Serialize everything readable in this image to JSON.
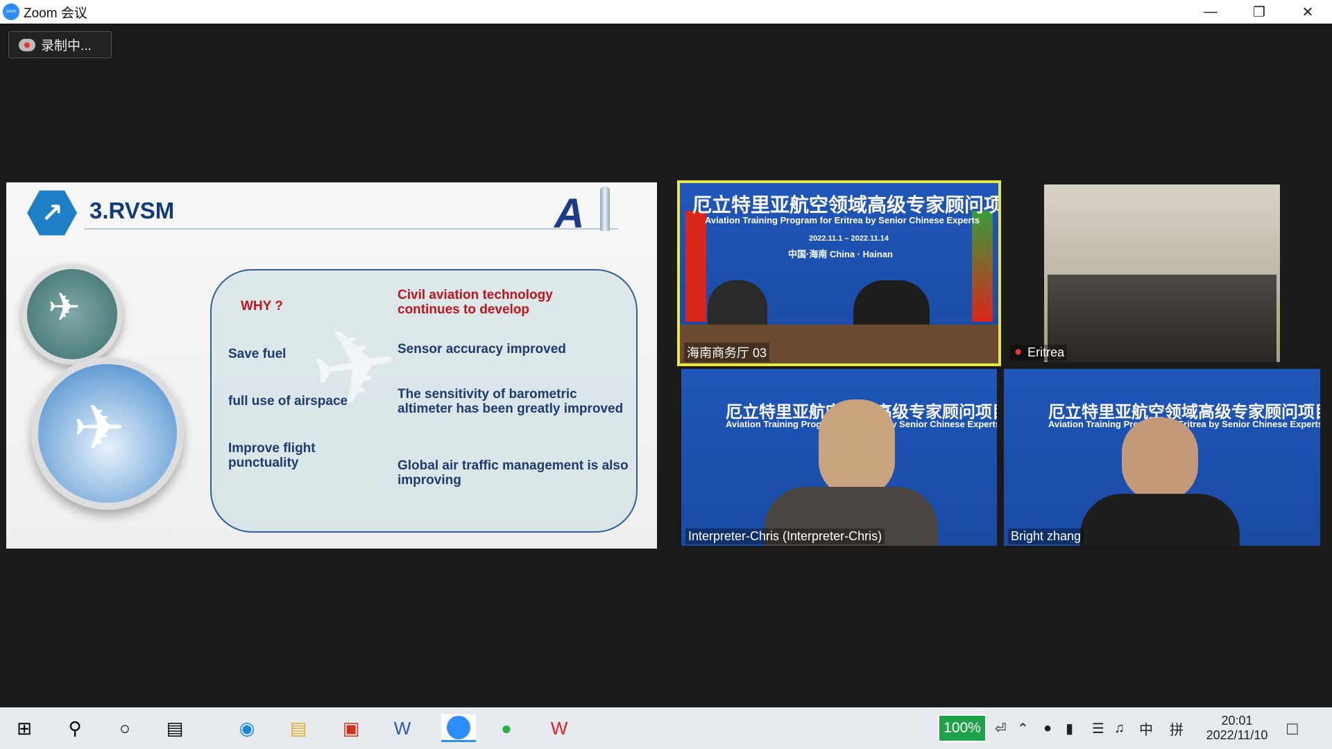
{
  "window": {
    "title": "Zoom 会议",
    "zoom_logo_text": "zoom"
  },
  "recording": {
    "label": "录制中..."
  },
  "slide": {
    "title": "3.RVSM",
    "why": "WHY ?",
    "left_items": [
      "Save fuel",
      "full use of airspace",
      "Improve flight punctuality"
    ],
    "right_header": "Civil aviation technology continues to develop",
    "right_items": [
      "Sensor accuracy improved",
      "The sensitivity of barometric altimeter has been greatly improved",
      "Global air traffic management is also improving"
    ]
  },
  "participants": [
    {
      "name": "海南商务厅 03",
      "active": true
    },
    {
      "name": "Eritrea",
      "muted": true
    },
    {
      "name": "Interpreter-Chris (Interpreter-Chris)"
    },
    {
      "name": "Bright zhang"
    }
  ],
  "banner": {
    "title_cn_1": "厄立特里亚航空领域高级专家顾问项目",
    "title_en_1": "Aviation Training Program for Eritrea by Senior Chinese Experts",
    "dates": "2022.11.1 – 2022.11.14",
    "location": "中国·海南      China · Hainan",
    "title_cn_2": "厄立特里亚航空领域高级专家顾问项目",
    "title_en_2": "Aviation Training Program for Eritrea by Senior Chinese Experts"
  },
  "taskbar": {
    "battery": "100%",
    "ime1": "中",
    "ime2": "拼",
    "time": "20:01",
    "date": "2022/11/10"
  }
}
